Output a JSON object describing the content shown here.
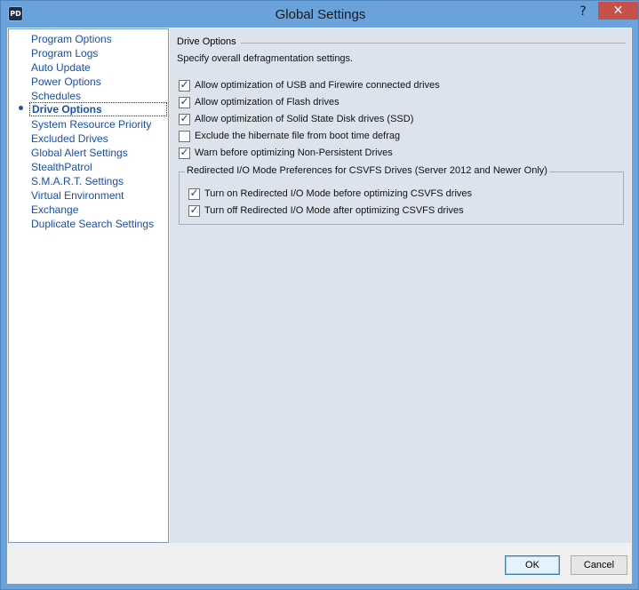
{
  "window": {
    "title": "Global Settings",
    "app_icon_text": "PD",
    "help_glyph": "?",
    "close_glyph": "✕"
  },
  "nav": {
    "items": [
      {
        "label": "Program Options",
        "selected": false
      },
      {
        "label": "Program Logs",
        "selected": false
      },
      {
        "label": "Auto Update",
        "selected": false
      },
      {
        "label": "Power Options",
        "selected": false
      },
      {
        "label": "Schedules",
        "selected": false
      },
      {
        "label": "Drive Options",
        "selected": true
      },
      {
        "label": "System Resource Priority",
        "selected": false
      },
      {
        "label": "Excluded Drives",
        "selected": false
      },
      {
        "label": "Global Alert Settings",
        "selected": false
      },
      {
        "label": "StealthPatrol",
        "selected": false
      },
      {
        "label": "S.M.A.R.T. Settings",
        "selected": false
      },
      {
        "label": "Virtual Environment",
        "selected": false
      },
      {
        "label": "Exchange",
        "selected": false
      },
      {
        "label": "Duplicate Search Settings",
        "selected": false
      }
    ]
  },
  "drive_options": {
    "group_title": "Drive Options",
    "description": "Specify overall defragmentation settings.",
    "options": [
      {
        "label": "Allow optimization of USB and Firewire connected drives",
        "checked": true
      },
      {
        "label": "Allow optimization of Flash drives",
        "checked": true
      },
      {
        "label": "Allow optimization of Solid State Disk drives (SSD)",
        "checked": true
      },
      {
        "label": "Exclude the hibernate file from boot time defrag",
        "checked": false
      },
      {
        "label": "Warn before optimizing Non-Persistent Drives",
        "checked": true
      }
    ],
    "redirected": {
      "title": "Redirected I/O Mode Preferences for CSVFS Drives (Server 2012 and Newer Only)",
      "options": [
        {
          "label": "Turn on Redirected I/O Mode before optimizing CSVFS drives",
          "checked": true
        },
        {
          "label": "Turn off Redirected I/O Mode after optimizing CSVFS drives",
          "checked": true
        }
      ]
    }
  },
  "footer": {
    "ok_label": "OK",
    "cancel_label": "Cancel"
  },
  "colors": {
    "titlebar": "#6aa3dc",
    "close_button": "#c7504a",
    "nav_link": "#1a4fb0",
    "content_bg": "#dde3ed",
    "checkmark": "#1c3f8a"
  }
}
